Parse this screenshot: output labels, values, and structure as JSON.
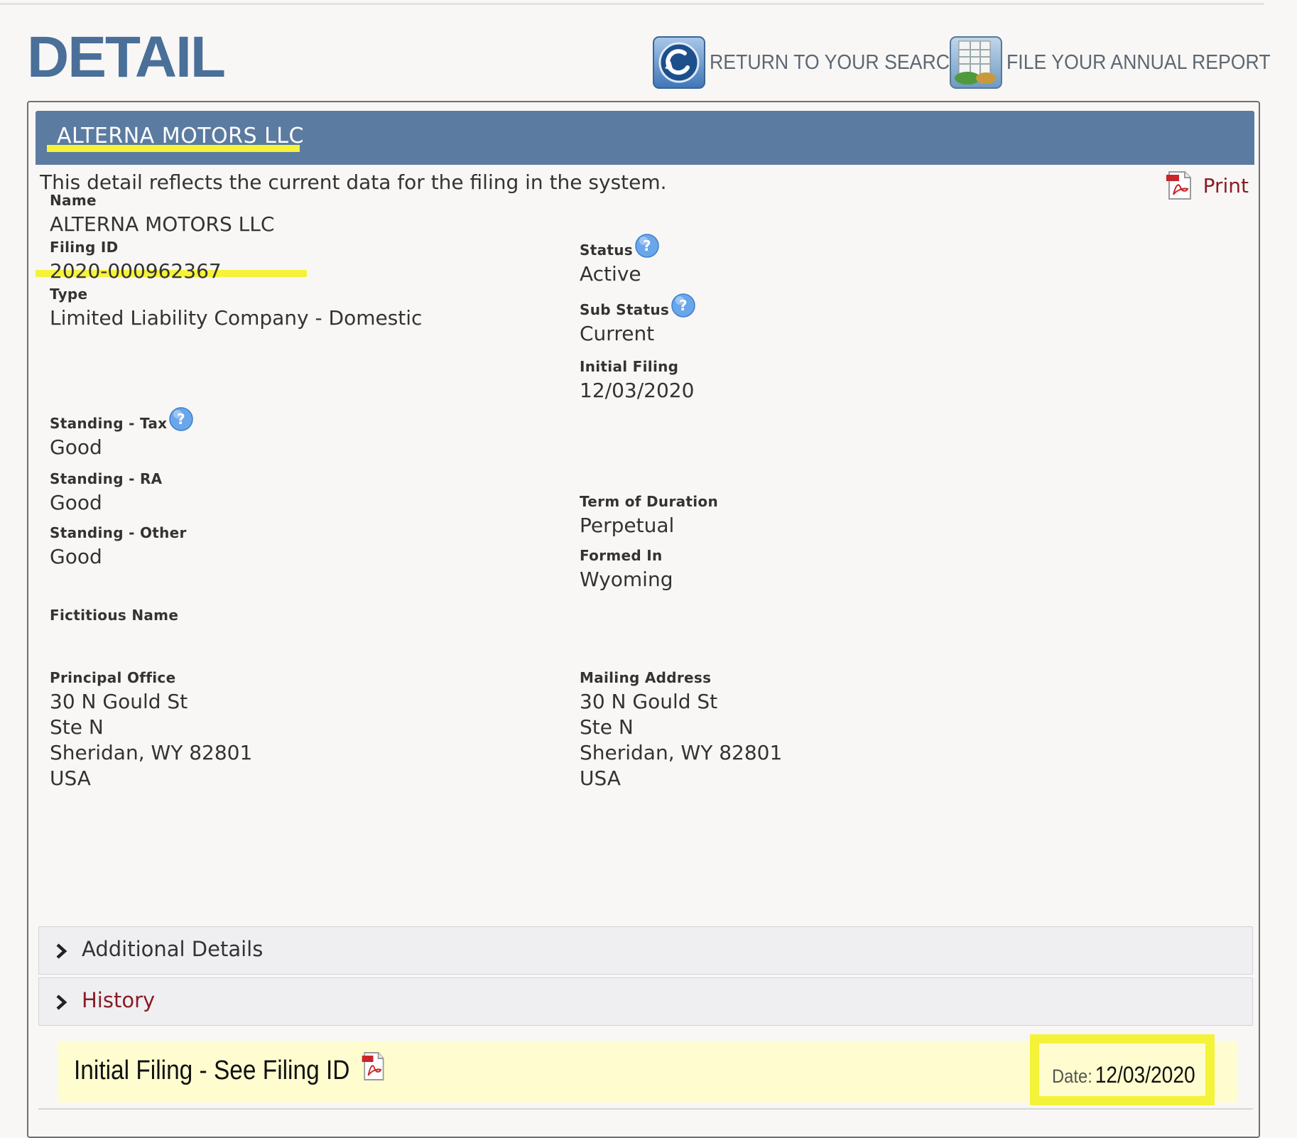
{
  "page": {
    "title": "DETAIL",
    "return_link": "RETURN TO YOUR SEARCH",
    "annual_link": "FILE YOUR ANNUAL REPORT"
  },
  "entity": {
    "header_name": "ALTERNA MOTORS LLC",
    "intro": "This detail reflects the current data for the filing in the system.",
    "print_label": "Print"
  },
  "fields": {
    "name": {
      "label": "Name",
      "value": "ALTERNA MOTORS LLC"
    },
    "filing_id": {
      "label": "Filing ID",
      "value": "2020-000962367"
    },
    "type": {
      "label": "Type",
      "value": "Limited Liability Company - Domestic"
    },
    "status": {
      "label": "Status",
      "value": "Active"
    },
    "sub_status": {
      "label": "Sub Status",
      "value": "Current"
    },
    "initial_filing": {
      "label": "Initial Filing",
      "value": "12/03/2020"
    },
    "standing_tax": {
      "label": "Standing - Tax",
      "value": "Good"
    },
    "standing_ra": {
      "label": "Standing - RA",
      "value": "Good"
    },
    "standing_other": {
      "label": "Standing - Other",
      "value": "Good"
    },
    "term_of_duration": {
      "label": "Term of Duration",
      "value": "Perpetual"
    },
    "formed_in": {
      "label": "Formed In",
      "value": "Wyoming"
    },
    "fictitious_name": {
      "label": "Fictitious Name",
      "value": ""
    },
    "principal_office": {
      "label": "Principal Office",
      "lines": [
        "30 N Gould St",
        "Ste N",
        "Sheridan, WY 82801",
        "USA"
      ]
    },
    "mailing_address": {
      "label": "Mailing Address",
      "lines": [
        "30 N Gould St",
        "Ste N",
        "Sheridan, WY 82801",
        "USA"
      ]
    }
  },
  "sections": {
    "additional_details": "Additional Details",
    "history": "History"
  },
  "history": {
    "entry_description": "Initial Filing - See Filing ID",
    "date_label": "Date:",
    "date_value": "12/03/2020"
  },
  "icons": {
    "return": "return-arrow-icon",
    "annual": "annual-report-icon",
    "help": "help-question-icon",
    "pdf": "pdf-document-icon",
    "chevron": "chevron-right-icon"
  },
  "colors": {
    "title": "#4a6f98",
    "header_bar": "#5b7ba1",
    "highlight": "#f5f23a",
    "history_row": "#fffdd0",
    "link_red": "#8a1c28"
  }
}
